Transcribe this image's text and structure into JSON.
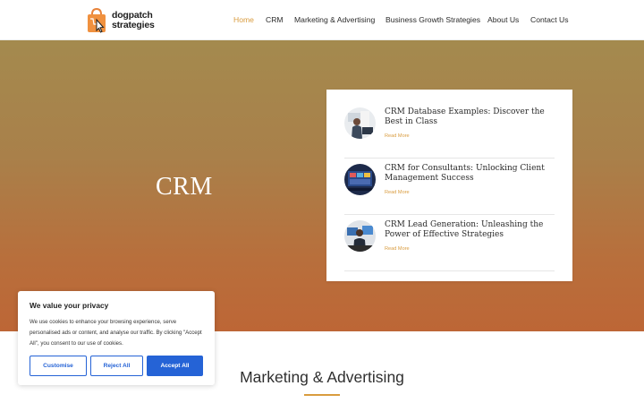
{
  "brand": {
    "logo_text_line1": "dogpatch",
    "logo_text_line2": "strategies",
    "accent_color": "#d99c3f"
  },
  "nav": {
    "items": [
      {
        "label": "Home",
        "active": true
      },
      {
        "label": "CRM",
        "active": false
      },
      {
        "label": "Marketing & Advertising",
        "active": false
      },
      {
        "label": "Business Growth Strategies",
        "active": false
      },
      {
        "label": "About Us",
        "active": false
      },
      {
        "label": "Contact Us",
        "active": false
      }
    ]
  },
  "hero": {
    "title": "CRM",
    "gradient_top": "#a48a4e",
    "gradient_bottom": "#bd6636"
  },
  "posts": [
    {
      "title": "CRM Database Examples: Discover the Best in Class",
      "read_more": "Read More",
      "thumb_icon": "person-at-computer-thumbnail"
    },
    {
      "title": "CRM for Consultants: Unlocking Client Management Success",
      "read_more": "Read More",
      "thumb_icon": "dashboard-screen-thumbnail"
    },
    {
      "title": "CRM Lead Generation: Unleashing the Power of Effective Strategies",
      "read_more": "Read More",
      "thumb_icon": "person-at-monitors-thumbnail"
    }
  ],
  "section": {
    "title": "Marketing & Advertising"
  },
  "cookie": {
    "title": "We value your privacy",
    "text": "We use cookies to enhance your browsing experience, serve personalised ads or content, and analyse our traffic. By clicking \"Accept All\", you consent to our use of cookies.",
    "customise_label": "Customise",
    "reject_label": "Reject All",
    "accept_label": "Accept All",
    "button_color": "#2563d6"
  }
}
